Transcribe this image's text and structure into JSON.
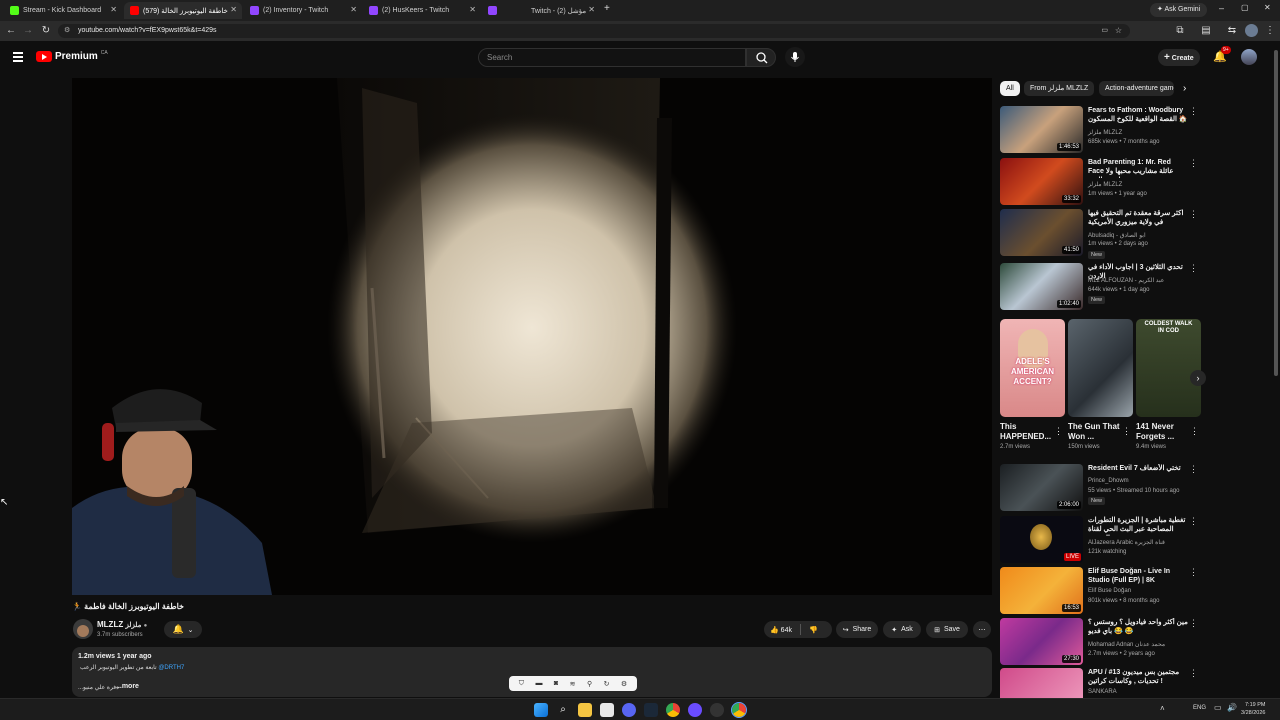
{
  "tabs": [
    {
      "title": "Stream - Kick Dashboard",
      "color": "#53fc18"
    },
    {
      "title": "خاطفة اليوتيوبرز الخالة (579)",
      "color": "#ff0000"
    },
    {
      "title": "(2) Inventory - Twitch",
      "color": "#9146ff"
    },
    {
      "title": "(2) HusKeers - Twitch",
      "color": "#9146ff"
    },
    {
      "title": "Twitch - مؤشل (2)",
      "color": "#9146ff"
    }
  ],
  "browser": {
    "url": "youtube.com/watch?v=fEX9pwst65k&t=429s",
    "ask_gemini": "Ask Gemini"
  },
  "header": {
    "logo": "Premium",
    "region": "CA",
    "search_placeholder": "Search",
    "create_label": "Create",
    "notif_count": "9+"
  },
  "video": {
    "title": "خاطفة اليوتيوبرز الخالة فاطمة 🏃",
    "channel": "MLZLZ",
    "channel_ar": "ملزلز",
    "subscribers": "3.7m subscribers",
    "likes": "64k",
    "share_label": "Share",
    "ask_label": "Ask",
    "save_label": "Save",
    "views_date": "1.2m views  1 year ago",
    "desc_line1": "تابعة من تطوير اليوتيوبر الرعب",
    "desc_link": "@DRTH7",
    "desc_line2": "...دفرة علي منيو",
    "more_label": "...more"
  },
  "chips": [
    "All",
    "From ملزلز MLZLZ",
    "Action-adventure games"
  ],
  "recommendations": [
    {
      "title": "Fears to Fathom : Woodbury القصة الواقعية للكوخ المسكون 🏠",
      "channel": "ملزلز MLZLZ",
      "meta": "685k views • 7 months ago",
      "duration": "1:46:53",
      "badge": ""
    },
    {
      "title": "Bad Parenting 1: Mr. Red Face عائلة مشاريب محبها ولا واحد صالحي",
      "channel": "ملزلز MLZLZ",
      "meta": "1m views • 1 year ago",
      "duration": "33:32",
      "badge": ""
    },
    {
      "title": "اكثر سرقة معقدة تم التحقيق فيها في ولاية ميزوري الأمريكية",
      "channel": "Abulsadiq - ابو الصادق",
      "meta": "1m views • 2 days ago",
      "duration": "41:50",
      "badge": "New"
    },
    {
      "title": "تحدي الثلاثين 3 | اجاوب الأداء في الاردن",
      "channel": "M12 ALFOUZAN - عبد الكريم",
      "meta": "644k views • 1 day ago",
      "duration": "1:02:40",
      "badge": "New"
    }
  ],
  "shorts": [
    {
      "title": "This HAPPENED...",
      "views": "2.7m views",
      "caption": "ADELE'S AMERICAN ACCENT?"
    },
    {
      "title": "The Gun That Won ...",
      "views": "150m views",
      "caption": ""
    },
    {
      "title": "141 Never Forgets ...",
      "views": "9.4m views",
      "caption": "COLDEST WALK IN COD"
    }
  ],
  "recommendations2": [
    {
      "title": "Resident Evil 7 تختي الأضعاف",
      "channel": "Prince_Dhowm",
      "meta": "55 views • Streamed 10 hours ago",
      "duration": "2:06:00",
      "badge": "New"
    },
    {
      "title": "تغطية مباشرة | الجزيرة التطورات المصاحبة عبر البث الحي لقناة الجزيرة",
      "channel": "AlJazeera Arabic قناة الجزيرة",
      "meta": "121k watching",
      "duration": "LIVE",
      "badge": ""
    },
    {
      "title": "Elif Buse Doğan - Live In Studio (Full EP) | 8K",
      "channel": "Elif Buse Doğan",
      "meta": "801k views • 8 months ago",
      "duration": "16:53",
      "badge": ""
    },
    {
      "title": "مين أكثر واحد فيادويل ؟ روستس ؟ باي فديو 😂 😂",
      "channel": "Mohamad Adnan محمد عدنان",
      "meta": "2.7m views • 2 years ago",
      "duration": "27:30",
      "badge": ""
    },
    {
      "title": "APU مجتمين بس ميديون 13# / تحديات , وكاسات كراتين !",
      "channel": "SANKARA",
      "meta": "",
      "duration": "",
      "badge": ""
    }
  ],
  "overlay_icons": [
    "shield",
    "clapper",
    "camera",
    "audio",
    "pin",
    "refresh",
    "settings"
  ],
  "taskbar": {
    "lang": "ENG",
    "time": "7:19 PM",
    "date": "3/28/2026"
  }
}
